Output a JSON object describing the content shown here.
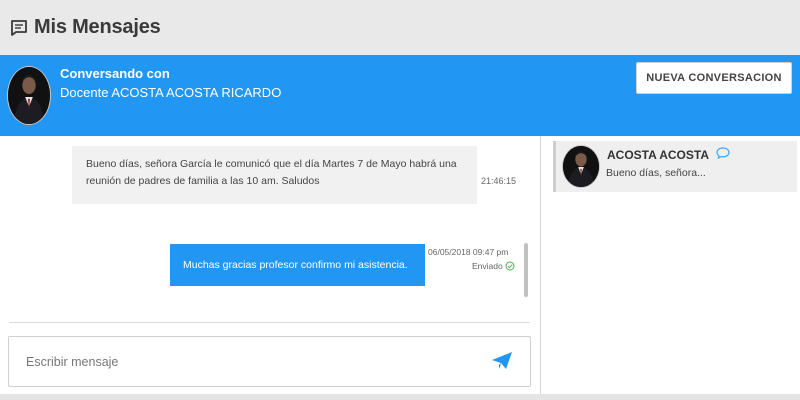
{
  "header": {
    "title": "Mis Mensajes",
    "icon": "message-icon"
  },
  "conversation": {
    "title": "Conversando con",
    "subtitle": "Docente ACOSTA ACOSTA RICARDO",
    "new_button_label": "NUEVA CONVERSACION",
    "accent_color": "#2196f3"
  },
  "messages": [
    {
      "direction": "incoming",
      "text": "Bueno días, señora García le comunicó que el día Martes 7 de Mayo habrá una reunión de padres de familia a las 10 am. Saludos",
      "time": "21:46:15"
    },
    {
      "direction": "outgoing",
      "text": "Muchas gracias profesor confirmo mi asistencia.",
      "datetime": "06/05/2018 09:47 pm",
      "status": "Enviado",
      "status_icon": "check-circle-icon"
    }
  ],
  "composer": {
    "placeholder": "Escribir mensaje",
    "send_icon": "paper-plane-icon"
  },
  "contacts": [
    {
      "name": "ACOSTA ACOSTA",
      "preview": "Bueno días, señora...",
      "icon": "chat-bubble-icon"
    }
  ]
}
